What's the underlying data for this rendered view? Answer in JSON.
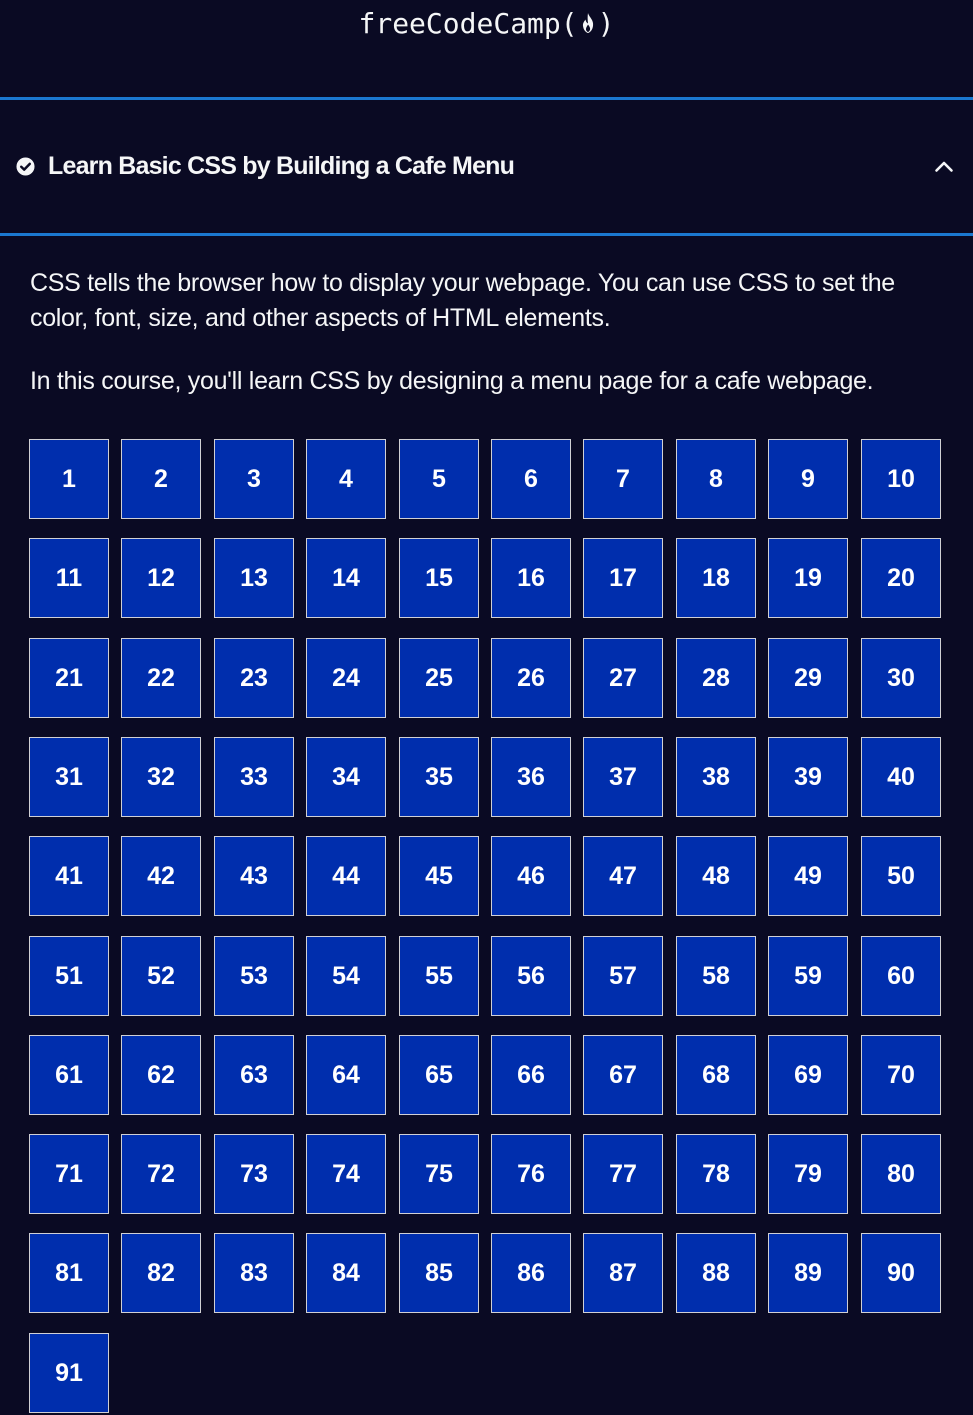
{
  "header": {
    "logo_text_left": "freeCodeCamp(",
    "logo_text_right": ")",
    "logo_icon": "flame-icon"
  },
  "block": {
    "icon": "check-circle-icon",
    "title": "Learn Basic CSS by Building a Cafe Menu",
    "toggle_icon": "chevron-up-icon",
    "expanded": true
  },
  "intro": {
    "p1": "CSS tells the browser how to display your webpage. You can use CSS to set the color, font, size, and other aspects of HTML elements.",
    "p2": "In this course, you'll learn CSS by designing a menu page for a cafe webpage."
  },
  "steps": [
    "1",
    "2",
    "3",
    "4",
    "5",
    "6",
    "7",
    "8",
    "9",
    "10",
    "11",
    "12",
    "13",
    "14",
    "15",
    "16",
    "17",
    "18",
    "19",
    "20",
    "21",
    "22",
    "23",
    "24",
    "25",
    "26",
    "27",
    "28",
    "29",
    "30",
    "31",
    "32",
    "33",
    "34",
    "35",
    "36",
    "37",
    "38",
    "39",
    "40",
    "41",
    "42",
    "43",
    "44",
    "45",
    "46",
    "47",
    "48",
    "49",
    "50",
    "51",
    "52",
    "53",
    "54",
    "55",
    "56",
    "57",
    "58",
    "59",
    "60",
    "61",
    "62",
    "63",
    "64",
    "65",
    "66",
    "67",
    "68",
    "69",
    "70",
    "71",
    "72",
    "73",
    "74",
    "75",
    "76",
    "77",
    "78",
    "79",
    "80",
    "81",
    "82",
    "83",
    "84",
    "85",
    "86",
    "87",
    "88",
    "89",
    "90",
    "91"
  ],
  "colors": {
    "background": "#0a0a23",
    "accent_rule": "#1b78d0",
    "step_fill": "#002ead",
    "step_border": "#d0d0d5",
    "text": "#f5f6f7"
  }
}
